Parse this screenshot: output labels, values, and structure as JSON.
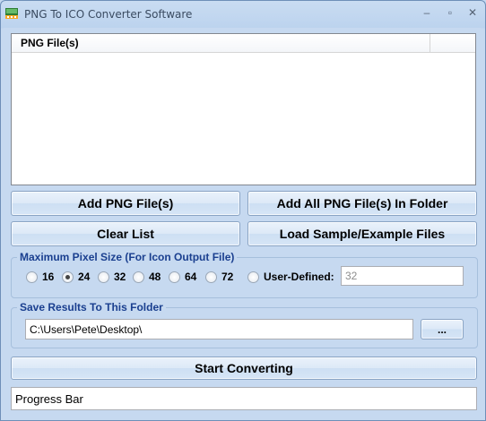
{
  "window": {
    "title": "PNG To ICO Converter Software"
  },
  "file_list": {
    "column_header": "PNG File(s)"
  },
  "buttons": {
    "add_png": "Add PNG File(s)",
    "add_all_folder": "Add All PNG File(s) In Folder",
    "clear_list": "Clear List",
    "load_sample": "Load Sample/Example Files",
    "browse": "...",
    "start": "Start Converting"
  },
  "pixel_size": {
    "group_label": "Maximum Pixel Size (For Icon Output File)",
    "options": [
      "16",
      "24",
      "32",
      "48",
      "64",
      "72"
    ],
    "selected": "24",
    "user_defined_label": "User-Defined:",
    "user_defined_value": "32"
  },
  "save_folder": {
    "group_label": "Save Results To This Folder",
    "path": "C:\\Users\\Pete\\Desktop\\"
  },
  "progress": {
    "label": "Progress Bar"
  }
}
